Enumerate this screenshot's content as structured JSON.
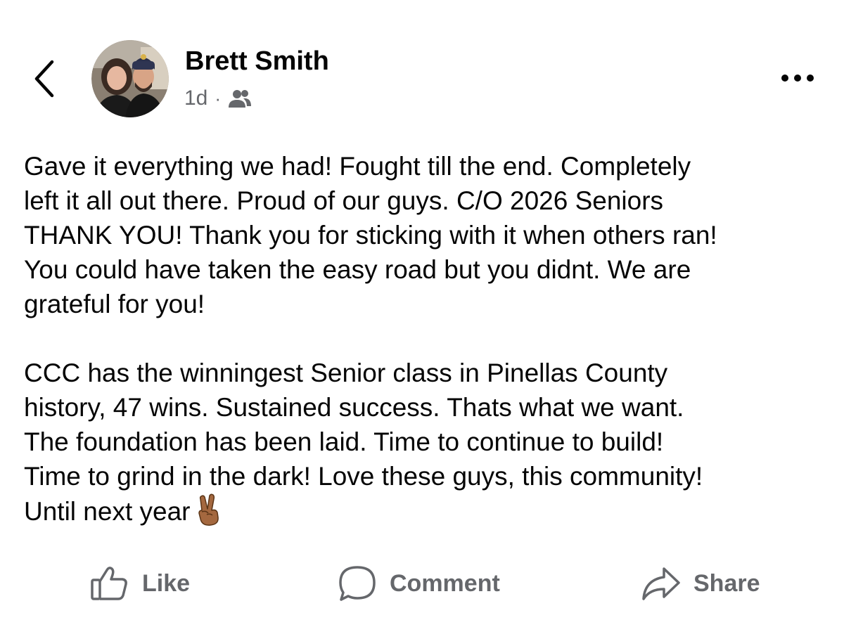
{
  "header": {
    "author_name": "Brett Smith",
    "timestamp": "1d",
    "separator": "·",
    "audience_icon": "friends-icon",
    "back_icon": "chevron-left-icon",
    "more_icon": "more-horizontal-icon"
  },
  "post": {
    "paragraph_1": "Gave it everything we had! Fought till the end. Completely\nleft it all out there. Proud of our guys. C/O 2026 Seniors\nTHANK YOU! Thank you for sticking with  it when others ran!\nYou could have taken the easy road but you didnt. We are\ngrateful for you!",
    "paragraph_2": "CCC has the winningest Senior class in Pinellas County\nhistory, 47 wins. Sustained success. Thats what we want.\nThe foundation has been laid. Time to continue to build!\nTime to grind in the dark! Love these guys, this community!\nUntil next year",
    "emoji": "victory-hand-medium-dark-skin-tone"
  },
  "actions": {
    "like_label": "Like",
    "comment_label": "Comment",
    "share_label": "Share"
  },
  "colors": {
    "text_primary": "#050505",
    "text_secondary": "#65676b",
    "background": "#ffffff"
  }
}
